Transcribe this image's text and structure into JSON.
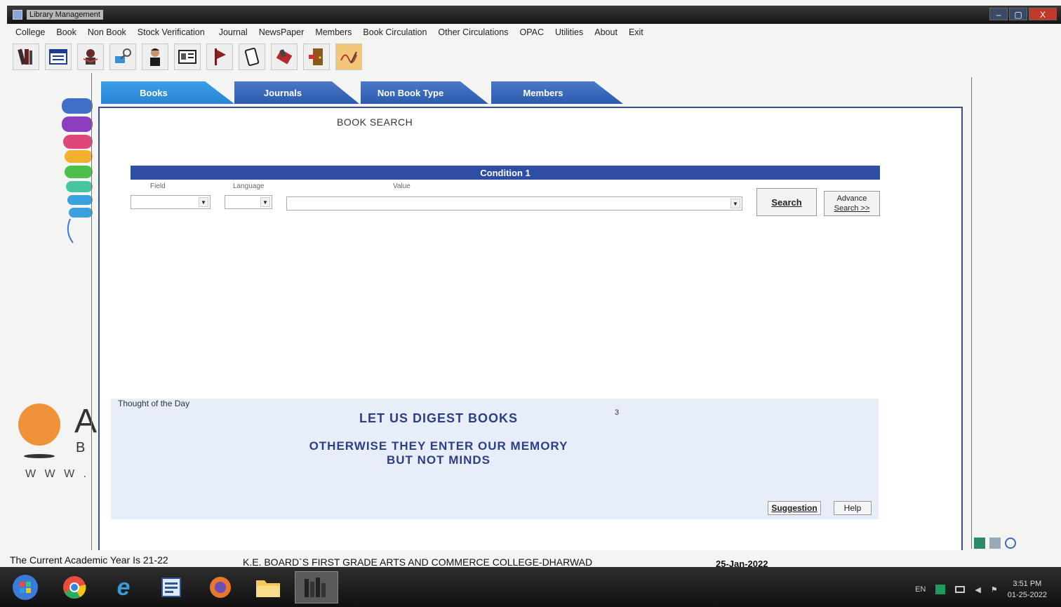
{
  "window": {
    "title": "Library Management",
    "controls": {
      "minimize": "–",
      "maximize": "▢",
      "close": "X"
    }
  },
  "menu": [
    "College",
    "Book",
    "Non Book",
    "Stock Verification",
    "Journal",
    "NewsPaper",
    "Members",
    "Book Circulation",
    "Other Circulations",
    "OPAC",
    "Utilities",
    "About",
    "Exit"
  ],
  "toolbar_icons": [
    "books-icon",
    "catalog-icon",
    "reader-icon",
    "key-search-icon",
    "person-icon",
    "id-card-icon",
    "bookmark-icon",
    "return-book-icon",
    "issue-book-icon",
    "exit-door-icon",
    "autograph-icon"
  ],
  "tabs": [
    "Books",
    "Journals",
    "Non Book Type",
    "Members"
  ],
  "active_tab": "Books",
  "search": {
    "title": "BOOK SEARCH",
    "condition_label": "Condition 1",
    "field_label": "Field",
    "language_label": "Language",
    "value_label": "Value",
    "field_value": "",
    "language_value": "",
    "value_value": "",
    "search_button": "Search",
    "advance_button_line1": "Advance",
    "advance_button_line2": "Search >>"
  },
  "thought": {
    "label": "Thought of the Day",
    "line1": "LET US DIGEST BOOKS",
    "number": "3",
    "line2": "OTHERWISE THEY ENTER OUR MEMORY",
    "line3": "BUT NOT MINDS",
    "suggestion_button": "Suggestion",
    "help_button": "Help"
  },
  "left_logo": {
    "big_letter": "A",
    "small_letter": "B",
    "url_fragment": "W W W ."
  },
  "status": {
    "academic_year": "The Current Academic Year Is 21-22",
    "college": "K.E. BOARD`S FIRST GRADE ARTS AND COMMERCE COLLEGE-DHARWAD",
    "date": "25-Jan-2022"
  },
  "taskbar": {
    "apps": [
      "start-orb-icon",
      "chrome-icon",
      "internet-explorer-icon",
      "word-icon",
      "firefox-icon",
      "file-explorer-icon",
      "library-app-icon"
    ],
    "language": "EN",
    "time": "3:51 PM",
    "date": "01-25-2022"
  },
  "colors": {
    "tab_blue": "#2c5aad",
    "active_tab": "#2a84d6",
    "condition_bar": "#2d4ea2",
    "thought_text": "#2c3f86",
    "thought_bg": "#e8eef9"
  }
}
